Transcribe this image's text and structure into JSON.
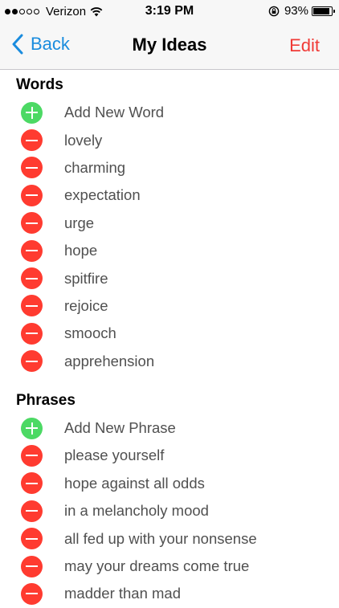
{
  "status_bar": {
    "carrier": "Verizon",
    "time": "3:19 PM",
    "battery_percent": "93%",
    "signal_full": 2,
    "signal_total": 5
  },
  "nav": {
    "back_label": "Back",
    "title": "My Ideas",
    "edit_label": "Edit"
  },
  "sections": {
    "words": {
      "header": "Words",
      "add_label": "Add New Word",
      "items": [
        "lovely",
        "charming",
        "expectation",
        "urge",
        "hope",
        "spitfire",
        "rejoice",
        "smooch",
        "apprehension"
      ]
    },
    "phrases": {
      "header": "Phrases",
      "add_label": "Add New Phrase",
      "items": [
        "please yourself",
        "hope against all odds",
        "in a melancholy mood",
        "all fed up with your nonsense",
        "may your dreams come true",
        "madder than mad"
      ]
    }
  },
  "colors": {
    "accent_blue": "#1a8cde",
    "edit_red": "#f03a36",
    "add_green": "#4cd964",
    "remove_red": "#ff3b30"
  }
}
